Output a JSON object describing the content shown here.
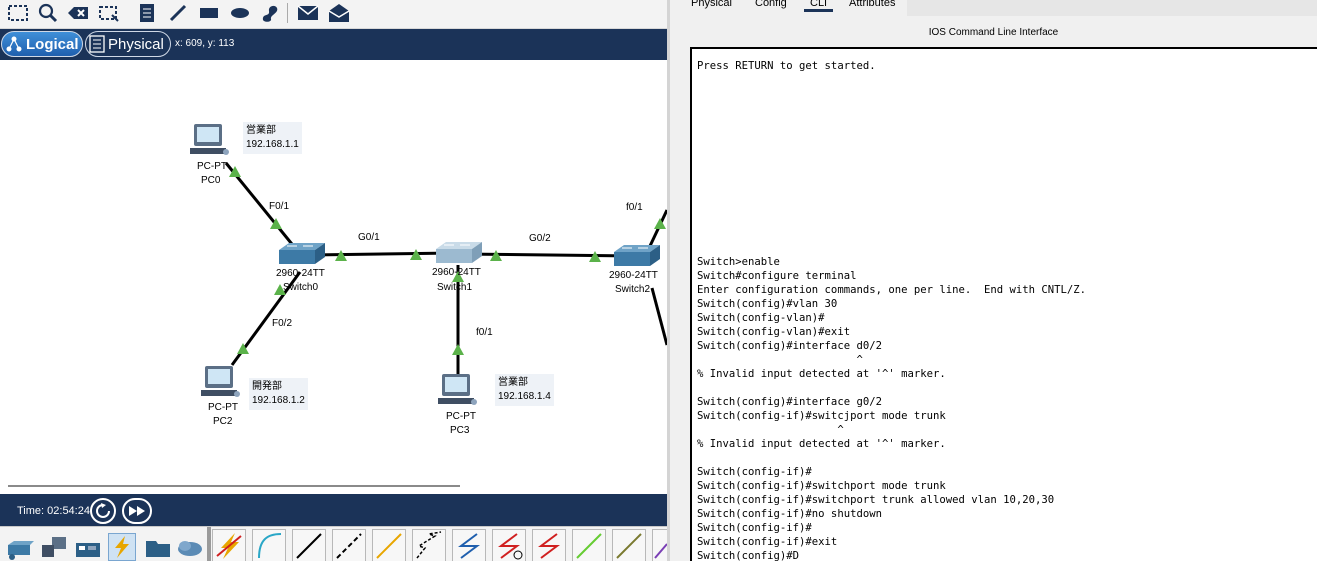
{
  "toolbar": {
    "tools": [
      "select-icon",
      "zoom-icon",
      "delete-icon",
      "resize-icon",
      "note-icon",
      "line-icon",
      "rectangle-icon",
      "ellipse-icon",
      "freeform-icon",
      "mail-icon",
      "open-mail-icon"
    ]
  },
  "modebar": {
    "logical_label": "Logical",
    "physical_label": "Physical",
    "coords": "x: 609, y: 113"
  },
  "topology": {
    "pc0": {
      "type": "PC-PT",
      "name": "PC0",
      "note_dept": "営業部",
      "note_ip": "192.168.1.1"
    },
    "pc2": {
      "type": "PC-PT",
      "name": "PC2",
      "note_dept": "開発部",
      "note_ip": "192.168.1.2"
    },
    "pc3": {
      "type": "PC-PT",
      "name": "PC3",
      "note_dept": "営業部",
      "note_ip": "192.168.1.4"
    },
    "switch0": {
      "model": "2960-24TT",
      "name": "Switch0"
    },
    "switch1": {
      "model": "2960-24TT",
      "name": "Switch1"
    },
    "switch2": {
      "model": "2960-24TT",
      "name": "Switch2"
    },
    "port_labels": {
      "sw0_pc0": "F0/1",
      "sw0_pc2": "F0/2",
      "sw0_sw1": "G0/1",
      "sw1_sw2": "G0/2",
      "sw1_pc3": "f0/1",
      "sw2_up": "f0/1"
    },
    "link_color": "#000000",
    "link_up_color": "#4caf50"
  },
  "timebar": {
    "time_label": "Time: 02:54:24"
  },
  "devices": {
    "categories": [
      "network-devices-icon",
      "end-devices-icon",
      "components-icon",
      "connections-icon",
      "misc-icon",
      "multiuser-icon"
    ],
    "cables": [
      "automatic-cable-icon",
      "console-cable-icon",
      "straight-through-icon",
      "crossover-icon",
      "fiber-icon",
      "phone-cable-icon",
      "coaxial-icon",
      "serial-dce-icon",
      "serial-dte-icon",
      "octal-cable-icon",
      "iot-cable-icon",
      "usb-cable-icon"
    ]
  },
  "cli": {
    "tabs": [
      "Physical",
      "Config",
      "CLI",
      "Attributes"
    ],
    "active_tab": "CLI",
    "title": "IOS Command Line Interface",
    "output": "Press RETURN to get started.\n\n\n\n\n\n\n\n\n\n\n\n\n\nSwitch>enable\nSwitch#configure terminal\nEnter configuration commands, one per line.  End with CNTL/Z.\nSwitch(config)#vlan 30\nSwitch(config-vlan)#\nSwitch(config-vlan)#exit\nSwitch(config)#interface d0/2\n                         ^\n% Invalid input detected at '^' marker.\n\nSwitch(config)#interface g0/2\nSwitch(config-if)#switcjport mode trunk\n                      ^\n% Invalid input detected at '^' marker.\n\nSwitch(config-if)#\nSwitch(config-if)#switchport mode trunk\nSwitch(config-if)#switchport trunk allowed vlan 10,20,30\nSwitch(config-if)#no shutdown\nSwitch(config-if)#\nSwitch(config-if)#exit\nSwitch(config)#D"
  }
}
